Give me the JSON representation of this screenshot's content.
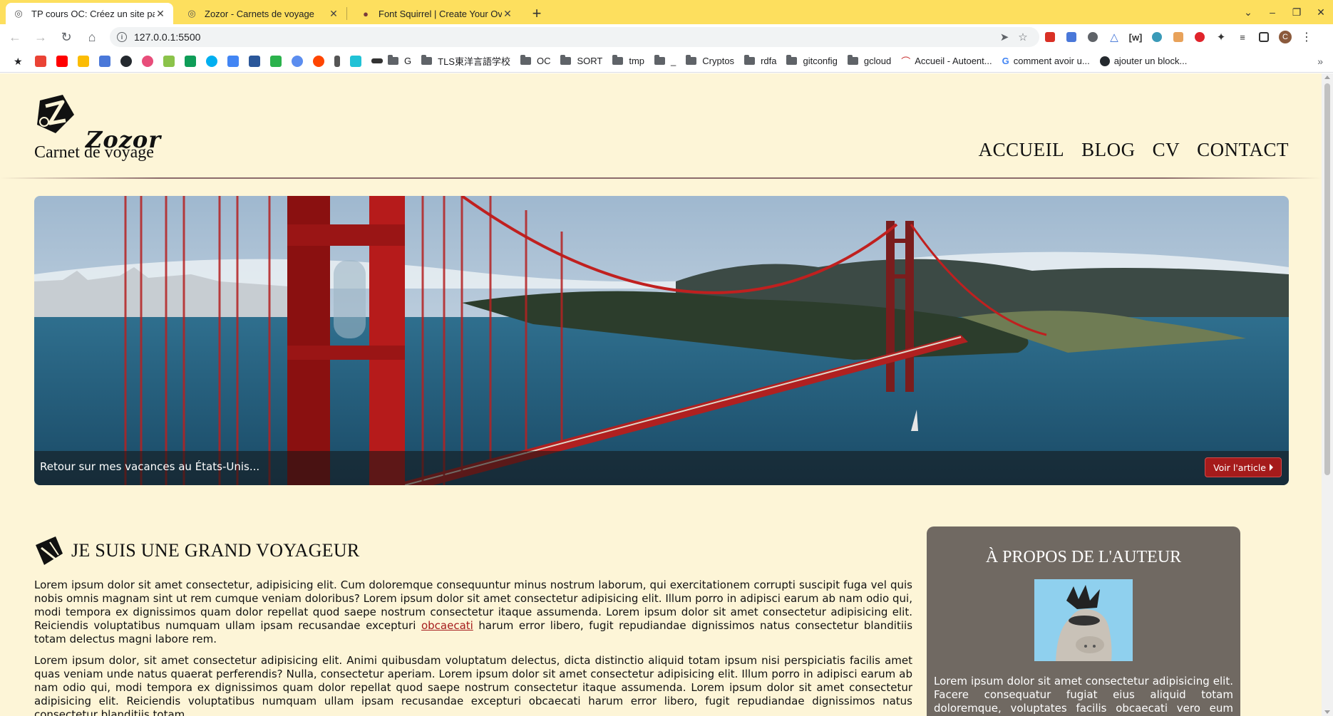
{
  "browser": {
    "tabs": [
      {
        "title": "TP cours OC: Créez un site pa",
        "active": true
      },
      {
        "title": "Zozor - Carnets de voyage",
        "active": false
      },
      {
        "title": "Font Squirrel | Create Your Ov",
        "active": false
      }
    ],
    "url": "127.0.0.1:5500",
    "profile_initial": "C",
    "bookmarks": [
      {
        "label": "G",
        "type": "folder"
      },
      {
        "label": "TLS東洋言語学校",
        "type": "folder"
      },
      {
        "label": "OC",
        "type": "folder"
      },
      {
        "label": "SORT",
        "type": "folder"
      },
      {
        "label": "tmp",
        "type": "folder"
      },
      {
        "label": "_",
        "type": "folder"
      },
      {
        "label": "Cryptos",
        "type": "folder"
      },
      {
        "label": "rdfa",
        "type": "folder"
      },
      {
        "label": "gitconfig",
        "type": "folder"
      },
      {
        "label": "gcloud",
        "type": "folder"
      },
      {
        "label": "Accueil - Autoent...",
        "type": "link"
      },
      {
        "label": "comment avoir u...",
        "type": "link"
      },
      {
        "label": "ajouter un block...",
        "type": "link"
      }
    ],
    "bookmark_more": "»"
  },
  "site": {
    "logo_name": "Zozor",
    "tagline": "Carnet de voyage",
    "nav": [
      "ACCUEIL",
      "BLOG",
      "CV",
      "CONTACT"
    ],
    "banner": {
      "caption": "Retour sur mes vacances au États-Unis...",
      "button": "Voir l'article"
    },
    "article": {
      "title": "JE SUIS UNE GRAND VOYAGEUR",
      "p1_before": "Lorem ipsum dolor sit amet consectetur, adipisicing elit. Cum doloremque consequuntur minus nostrum laborum, qui exercitationem corrupti suscipit fuga vel quis nobis omnis magnam sint ut rem cumque veniam doloribus? Lorem ipsum dolor sit amet consectetur adipisicing elit. Illum porro in adipisci earum ab nam odio qui, modi tempora ex dignissimos quam dolor repellat quod saepe nostrum consectetur itaque assumenda. Lorem ipsum dolor sit amet consectetur adipisicing elit. Reiciendis voluptatibus numquam ullam ipsam recusandae excepturi ",
      "p1_link": "obcaecati",
      "p1_after": " harum error libero, fugit repudiandae dignissimos natus consectetur blanditiis totam delectus magni labore rem.",
      "p2": "Lorem ipsum dolor, sit amet consectetur adipisicing elit. Animi quibusdam voluptatum delectus, dicta distinctio aliquid totam ipsum nisi perspiciatis facilis amet quas veniam unde natus quaerat perferendis? Nulla, consectetur aperiam. Lorem ipsum dolor sit amet consectetur adipisicing elit. Illum porro in adipisci earum ab nam odio qui, modi tempora ex dignissimos quam dolor repellat quod saepe nostrum consectetur itaque assumenda. Lorem ipsum dolor sit amet consectetur adipisicing elit. Reiciendis voluptatibus numquam ullam ipsam recusandae excepturi obcaecati harum error libero, fugit repudiandae dignissimos natus consectetur blanditiis totam"
    },
    "aside": {
      "title": "À PROPOS DE L'AUTEUR",
      "text": "Lorem ipsum dolor sit amet consectetur adipisicing elit. Facere consequatur fugiat eius aliquid totam doloremque, voluptates facilis obcaecati vero eum similique cumque in"
    }
  },
  "colors": {
    "tabbar": "#fddf5e",
    "page_bg": "#fdf5d7",
    "accent_red": "#a51b1b",
    "aside_bg": "#706962"
  }
}
